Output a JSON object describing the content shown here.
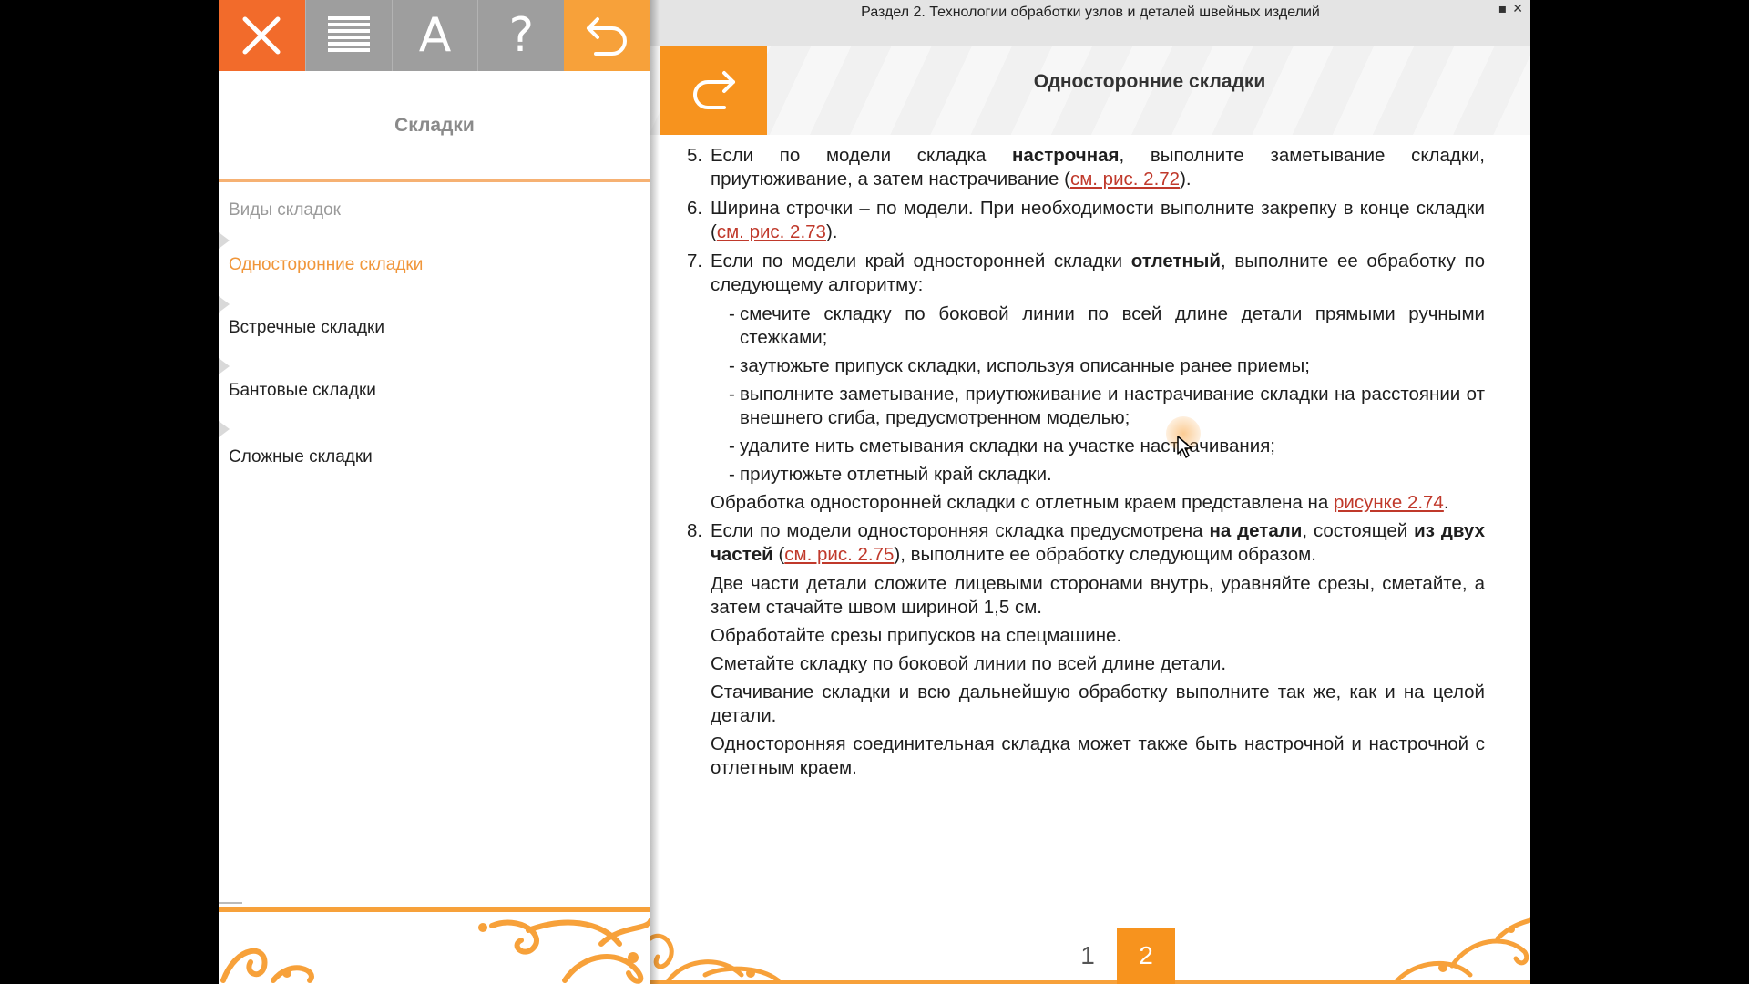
{
  "colors": {
    "accent_orange": "#f7931e",
    "close_red": "#f26b2b",
    "toolbar_gray": "#9e9e9e",
    "link_red": "#c0392b",
    "active_item": "#f0963a"
  },
  "toolbar": {
    "buttons": [
      {
        "icon": "close-icon"
      },
      {
        "icon": "menu-lines-icon"
      },
      {
        "icon": "font-icon",
        "glyph": "A"
      },
      {
        "icon": "help-icon",
        "glyph": "?"
      },
      {
        "icon": "undo-arrow-icon"
      }
    ]
  },
  "left": {
    "title": "Складки",
    "toc_heading": "Виды складок",
    "items": [
      {
        "label": "Односторонние складки",
        "active": true
      },
      {
        "label": "Встречные складки",
        "active": false
      },
      {
        "label": "Бантовые складки",
        "active": false
      },
      {
        "label": "Сложные складки",
        "active": false
      }
    ]
  },
  "header": {
    "section_title": "Раздел 2. Технологии обработки узлов и деталей швейных изделий",
    "page_title": "Односторонние складки",
    "window_controls": [
      "▪",
      "✕"
    ]
  },
  "content": {
    "item5": {
      "num": "5.",
      "t1": "Если по модели складка ",
      "b1": "настрочная",
      "t2": ", выполните заметывание складки, приутюживание, а затем настрачивание (",
      "link": "см. рис. 2.72",
      "t3": ")."
    },
    "item6": {
      "num": "6.",
      "t1": "Ширина строчки – по модели. При необходимости выполните закрепку в конце складки (",
      "link": "см. рис. 2.73",
      "t2": ")."
    },
    "item7": {
      "num": "7.",
      "t1": "Если по модели край односторонней складки ",
      "b1": "отлетный",
      "t2": ", выполните ее обработку по следующему алгоритму:"
    },
    "dashes": [
      "смечите складку по боковой линии по всей длине детали прямыми ручными стежками;",
      "заутюжьте припуск складки, используя описанные ранее приемы;",
      "выполните заметывание, приутюживание и настрачивание складки на расстоянии от внешнего сгиба, предусмотренном моделью;",
      "удалите нить сметывания складки на участке настрачивания;",
      "приутюжьте отлетный край складки."
    ],
    "para7": {
      "t1": "Обработка односторонней складки с отлетным краем представлена на ",
      "link": "рисунке 2.74",
      "t2": "."
    },
    "item8": {
      "num": "8.",
      "t1": "Если по модели односторонняя складка предусмотрена ",
      "b1": "на детали",
      "t2": ", состоящей ",
      "b2": "из двух частей",
      "t3": " (",
      "link": "см. рис. 2.75",
      "t4": "), выполните ее обработку следующим образом."
    },
    "paras": [
      "Две части детали сложите лицевыми сторонами внутрь, уравняйте срезы, сметайте, а затем стачайте швом шириной 1,5 см.",
      "Обработайте срезы припусков на спецмашине.",
      "Сметайте складку по боковой линии по всей длине детали.",
      "Стачивание складки и всю дальнейшую обработку выполните так же, как и на целой детали.",
      "Односторонняя соединительная складка может также быть настрочной и настрочной с отлетным краем."
    ]
  },
  "pager": {
    "pages": [
      "1",
      "2"
    ],
    "current": "2"
  }
}
